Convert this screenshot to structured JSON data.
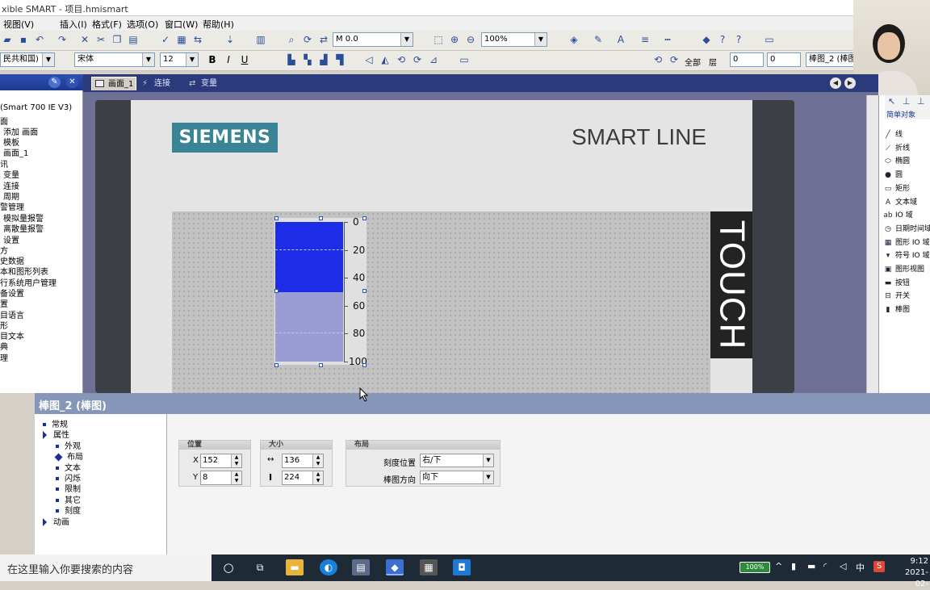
{
  "window": {
    "title": "xible SMART - 项目.hmismart"
  },
  "menu": [
    "图(V)",
    "插入(I)",
    "格式(F)",
    "选项(O)",
    "窗口(W)",
    "帮助(H)",
    "视图(V)"
  ],
  "menu_items": [
    {
      "label": "视图(V)"
    },
    {
      "label": "插入(I)"
    },
    {
      "label": "格式(F)"
    },
    {
      "label": "选项(O)"
    },
    {
      "label": "窗口(W)"
    },
    {
      "label": "帮助(H)"
    }
  ],
  "toolbar": {
    "tag_combo": "M 0.0",
    "zoom_combo": "100%",
    "lang_combo": "民共和国)",
    "font_combo": "宋体",
    "size_combo": "12",
    "all_label": "全部",
    "layer_label": "层",
    "layer_value1": "0",
    "layer_value2": "0",
    "object_combo": "棒图_2 (棒图"
  },
  "project_tree": [
    "(Smart 700 IE V3)",
    "面",
    "添加 画面",
    "模板",
    "画面_1",
    "讯",
    "变量",
    "连接",
    "周期",
    "警管理",
    "模拟量报警",
    "离散量报警",
    "设置",
    "方",
    "史数据",
    "本和图形列表",
    "行系统用户管理",
    "备设置",
    "置",
    "目语言",
    "形",
    "目文本",
    "典",
    "理"
  ],
  "tabs": [
    {
      "label": "画面_1",
      "active": true
    },
    {
      "label": "连接",
      "active": false
    },
    {
      "label": "变量",
      "active": false
    }
  ],
  "device": {
    "brand": "SIEMENS",
    "model": "SMART LINE",
    "touch": "TOUCH"
  },
  "bar": {
    "scale": [
      "0",
      "20",
      "40",
      "60",
      "80",
      "100"
    ],
    "fill_fraction": 0.5
  },
  "toolbox": {
    "header": "简单对象",
    "items": [
      "线",
      "折线",
      "椭圆",
      "圆",
      "矩形",
      "文本域",
      "IO 域",
      "日期时间域",
      "图形 IO 域",
      "符号 IO 域",
      "图形视图",
      "按钮",
      "开关",
      "棒图"
    ]
  },
  "properties": {
    "title": "棒图_2 (棒图)",
    "tree": [
      {
        "label": "常规",
        "marker": "square",
        "level": 0
      },
      {
        "label": "属性",
        "marker": "triangle",
        "level": 0
      },
      {
        "label": "外观",
        "marker": "square",
        "level": 1
      },
      {
        "label": "布局",
        "marker": "diamond",
        "level": 1
      },
      {
        "label": "文本",
        "marker": "square",
        "level": 1
      },
      {
        "label": "闪烁",
        "marker": "square",
        "level": 1
      },
      {
        "label": "限制",
        "marker": "square",
        "level": 1
      },
      {
        "label": "其它",
        "marker": "square",
        "level": 1
      },
      {
        "label": "刻度",
        "marker": "square",
        "level": 1
      },
      {
        "label": "动画",
        "marker": "triangle",
        "level": 0
      }
    ],
    "position": {
      "header": "位置",
      "x_label": "X",
      "x": "152",
      "y_label": "Y",
      "y": "8"
    },
    "size": {
      "header": "大小",
      "w": "136",
      "h": "224"
    },
    "layout": {
      "header": "布局",
      "scale_pos_label": "刻度位置",
      "scale_pos": "右/下",
      "bar_dir_label": "棒图方向",
      "bar_dir": "向下"
    }
  },
  "taskbar": {
    "search_placeholder": "在这里输入你要搜索的内容",
    "battery": "100%",
    "time": "9:12",
    "date": "2021-02-"
  }
}
